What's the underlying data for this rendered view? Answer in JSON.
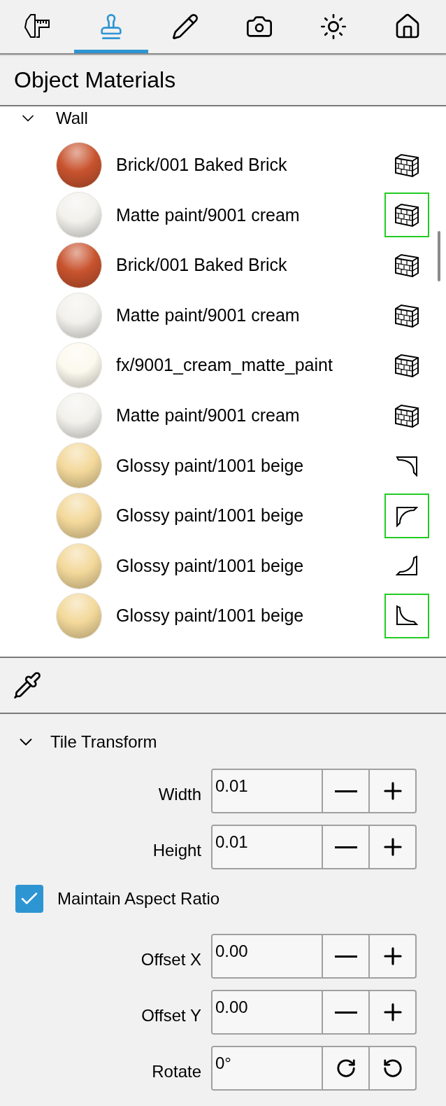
{
  "tabs": [
    {
      "kind": "caliper",
      "selected": false
    },
    {
      "kind": "stamp",
      "selected": true
    },
    {
      "kind": "pencil",
      "selected": false
    },
    {
      "kind": "camera",
      "selected": false
    },
    {
      "kind": "sun",
      "selected": false
    },
    {
      "kind": "house",
      "selected": false
    }
  ],
  "title": "Object Materials",
  "group": {
    "label": "Wall",
    "expanded": true,
    "materials": [
      {
        "name": "Brick/001 Baked Brick",
        "color": "#c8532e",
        "kind": "wall",
        "highlighted": false
      },
      {
        "name": "Matte paint/9001 cream",
        "color": "#f2f1ec",
        "kind": "wall",
        "highlighted": true
      },
      {
        "name": "Brick/001 Baked Brick",
        "color": "#c8532e",
        "kind": "wall",
        "highlighted": false
      },
      {
        "name": "Matte paint/9001 cream",
        "color": "#f2f1ec",
        "kind": "wall",
        "highlighted": false
      },
      {
        "name": "fx/9001_cream_matte_paint",
        "color": "#fcf9ee",
        "kind": "wall",
        "highlighted": false
      },
      {
        "name": "Matte paint/9001 cream",
        "color": "#f2f1ec",
        "kind": "wall",
        "highlighted": false
      },
      {
        "name": "Glossy paint/1001 beige",
        "color": "#f3d89a",
        "kind": "corner-top-right",
        "highlighted": false
      },
      {
        "name": "Glossy paint/1001 beige",
        "color": "#f3d89a",
        "kind": "corner-top-left",
        "highlighted": true
      },
      {
        "name": "Glossy paint/1001 beige",
        "color": "#f3d89a",
        "kind": "corner-bottom-right",
        "highlighted": false
      },
      {
        "name": "Glossy paint/1001 beige",
        "color": "#f3d89a",
        "kind": "corner-bottom-left",
        "highlighted": true
      }
    ]
  },
  "tile_transform": {
    "label": "Tile Transform",
    "expanded": true,
    "fields": [
      {
        "label": "Width",
        "value": "0.01",
        "kind": "step"
      },
      {
        "label": "Height",
        "value": "0.01",
        "kind": "step"
      }
    ],
    "aspect": {
      "label": "Maintain Aspect Ratio",
      "checked": true
    },
    "fields2": [
      {
        "label": "Offset X",
        "value": "0.00",
        "kind": "step"
      },
      {
        "label": "Offset Y",
        "value": "0.00",
        "kind": "step"
      },
      {
        "label": "Rotate",
        "value": "0°",
        "kind": "rotate"
      }
    ]
  }
}
